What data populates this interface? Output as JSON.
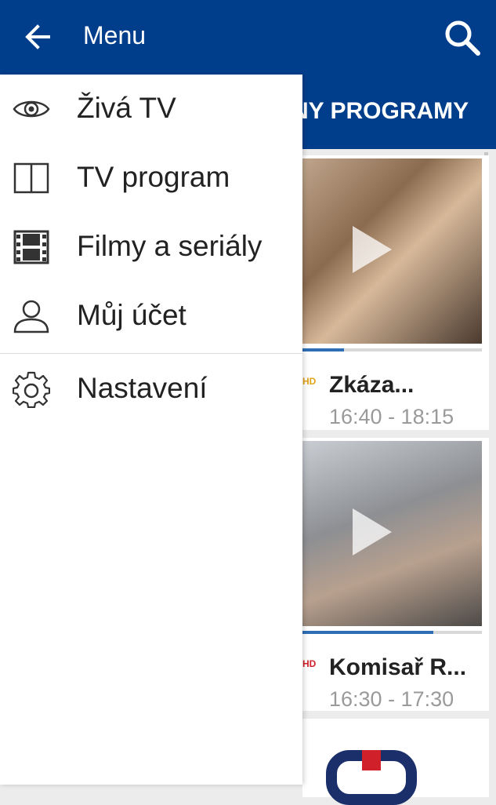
{
  "appbar": {
    "title": "Menu",
    "back_icon": "arrow-left-icon",
    "search_icon": "search-icon",
    "color": "#003e8c"
  },
  "tabs": {
    "active_label": "NY PROGRAMY"
  },
  "drawer": {
    "items": [
      {
        "label": "Živá TV",
        "icon": "eye-icon"
      },
      {
        "label": "TV program",
        "icon": "book-icon"
      },
      {
        "label": "Filmy a seriály",
        "icon": "film-icon"
      },
      {
        "label": "Můj účet",
        "icon": "user-icon"
      },
      {
        "label": "Nastavení",
        "icon": "gear-icon"
      }
    ]
  },
  "cards": [
    {
      "title": "Zkáza...",
      "time": "16:40 - 18:15",
      "channel_badge": "HD",
      "progress": 0.23
    },
    {
      "title": "Komisař R...",
      "time": "16:30 - 17:30",
      "channel_badge": "HD",
      "progress": 0.73
    }
  ]
}
